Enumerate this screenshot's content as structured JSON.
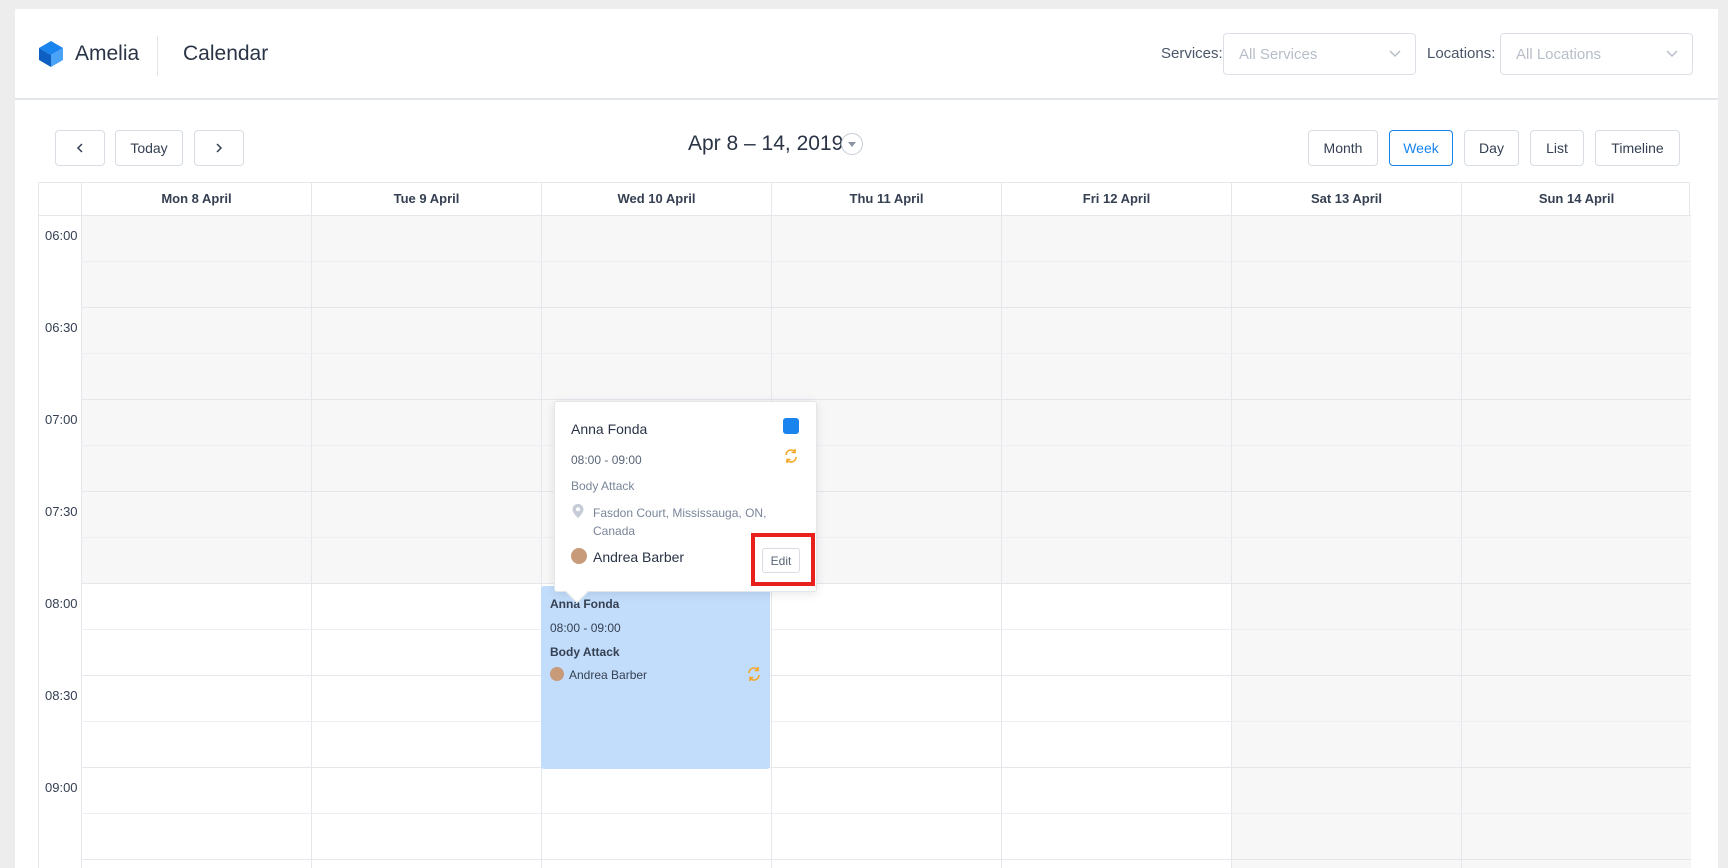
{
  "header": {
    "brand": "Amelia",
    "title": "Calendar",
    "services_label": "Services:",
    "services_placeholder": "All Services",
    "locations_label": "Locations:",
    "locations_placeholder": "All Locations"
  },
  "toolbar": {
    "today_label": "Today",
    "date_range": "Apr 8 – 14, 2019",
    "views": [
      "Month",
      "Week",
      "Day",
      "List",
      "Timeline"
    ],
    "active_view": "Week"
  },
  "calendar": {
    "days": [
      "Mon 8 April",
      "Tue 9 April",
      "Wed 10 April",
      "Thu 11 April",
      "Fri 12 April",
      "Sat 13 April",
      "Sun 14 April"
    ],
    "times": [
      "06:00",
      "06:30",
      "07:00",
      "07:30",
      "08:00",
      "08:30",
      "09:00"
    ]
  },
  "event": {
    "customer": "Anna Fonda",
    "time": "08:00 - 09:00",
    "service": "Body Attack",
    "employee": "Andrea Barber"
  },
  "popover": {
    "customer": "Anna Fonda",
    "time": "08:00 - 09:00",
    "service": "Body Attack",
    "location": "Fasdon Court, Mississauga, ON, Canada",
    "employee": "Andrea Barber",
    "edit_label": "Edit",
    "color": "#1a84ee"
  },
  "colors": {
    "accent": "#1a84ee",
    "event_bg": "#c2ddfb",
    "recurring_icon": "#f5a623",
    "highlight": "#e8211c"
  }
}
